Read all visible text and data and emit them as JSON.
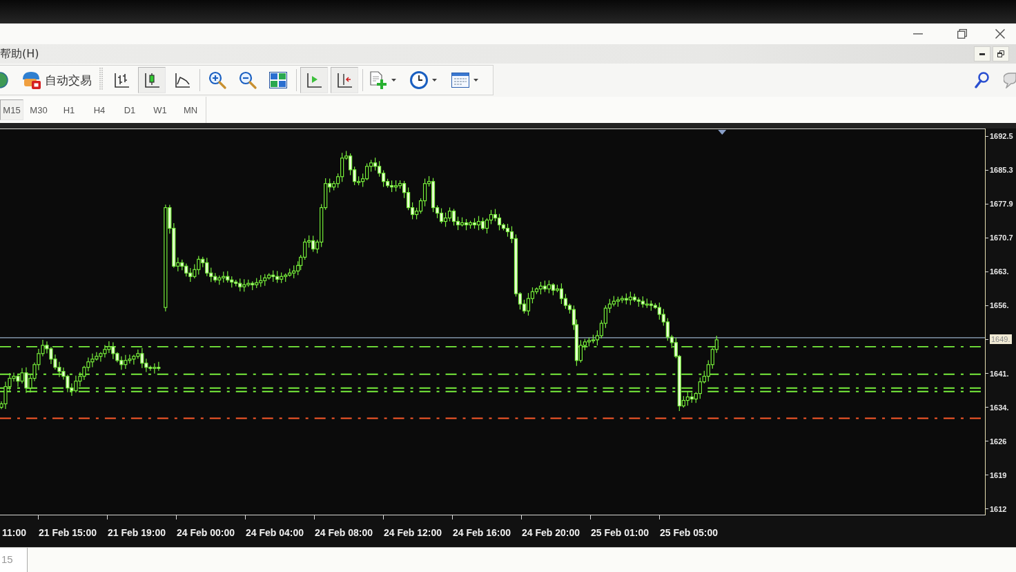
{
  "menu_bar": {
    "items": [
      "帮助(H)"
    ]
  },
  "toolbar": {
    "auto_trading": {
      "label": "自动交易"
    },
    "chart_types": [
      {
        "selected": false
      },
      {
        "selected": true
      },
      {
        "selected": false
      }
    ],
    "toggles": [
      {
        "on": true
      },
      {
        "on": true
      }
    ]
  },
  "timeframes": [
    {
      "label": "M15",
      "selected": true
    },
    {
      "label": "M30",
      "selected": false
    },
    {
      "label": "H1",
      "selected": false
    },
    {
      "label": "H4",
      "selected": false
    },
    {
      "label": "D1",
      "selected": false
    },
    {
      "label": "W1",
      "selected": false
    },
    {
      "label": "MN",
      "selected": false
    }
  ],
  "chart": {
    "price_axis": [
      {
        "kind": "tick",
        "text": "1692.5"
      },
      {
        "kind": "tick",
        "text": "1685.3"
      },
      {
        "kind": "tick",
        "text": "1677.9"
      },
      {
        "kind": "tick",
        "text": "1670.7"
      },
      {
        "kind": "tick",
        "text": "1663."
      },
      {
        "kind": "tick",
        "text": "1656."
      },
      {
        "kind": "bid",
        "text": "1649."
      },
      {
        "kind": "tick",
        "text": "1641."
      },
      {
        "kind": "tick",
        "text": "1634."
      },
      {
        "kind": "tick",
        "text": "1626"
      },
      {
        "kind": "tick",
        "text": "1619"
      },
      {
        "kind": "tick",
        "text": "1612"
      }
    ],
    "time_axis": [
      "11:00",
      "21 Feb 15:00",
      "21 Feb 19:00",
      "24 Feb 00:00",
      "24 Feb 04:00",
      "24 Feb 08:00",
      "24 Feb 12:00",
      "24 Feb 16:00",
      "24 Feb 20:00",
      "25 Feb 01:00",
      "25 Feb 05:00"
    ]
  },
  "tabs": [
    {
      "label": "15"
    }
  ]
}
